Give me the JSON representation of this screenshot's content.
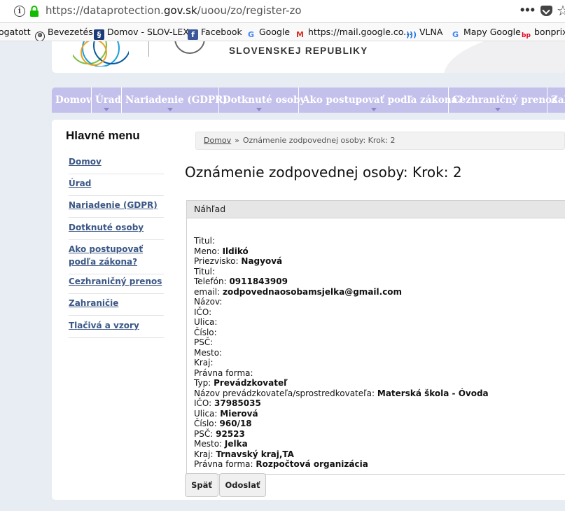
{
  "browser": {
    "url_prefix": "https://dataprotection.",
    "url_domain": "gov.sk",
    "url_path": "/uoou/zo/register-zo",
    "bookmarks": [
      {
        "label": "ogatott",
        "icon": ""
      },
      {
        "label": "Bevezetés",
        "icon": "globe-icon"
      },
      {
        "label": "Domov - SLOV-LEX",
        "icon": "section-icon"
      },
      {
        "label": "Facebook",
        "icon": "facebook-icon"
      },
      {
        "label": "Google",
        "icon": "google-icon"
      },
      {
        "label": "https://mail.google.co...",
        "icon": "gmail-icon"
      },
      {
        "label": "VLNA",
        "icon": "wave-icon"
      },
      {
        "label": "Mapy Google",
        "icon": "google-icon"
      },
      {
        "label": "bonprix",
        "icon": "bonprix-icon"
      }
    ]
  },
  "header": {
    "office_line2": "SLOVENSKEJ REPUBLIKY"
  },
  "nav": [
    "Domov",
    "Úrad",
    "Nariadenie (GDPR)",
    "Dotknuté osoby",
    "Ako postupovať podľa zákona?",
    "Cezhraničný prenos",
    "Zahraničie"
  ],
  "sidebar": {
    "title": "Hlavné menu",
    "items": [
      "Domov",
      "Úrad",
      "Nariadenie (GDPR)",
      "Dotknuté osoby",
      "Ako postupovať podľa zákona?",
      "Cezhraničný prenos",
      "Zahraničie",
      "Tlačivá a vzory"
    ]
  },
  "breadcrumb": {
    "home": "Domov",
    "separator": "»",
    "current": "Oznámenie zodpovednej osoby: Krok: 2"
  },
  "page_title": "Oznámenie zodpovednej osoby: Krok: 2",
  "panel": {
    "title": "Náhľad",
    "rows": [
      {
        "label": "Titul:",
        "value": ""
      },
      {
        "label": "Meno:",
        "value": "Ildikó"
      },
      {
        "label": "Priezvisko:",
        "value": "Nagyová"
      },
      {
        "label": "Titul:",
        "value": ""
      },
      {
        "label": "Telefón:",
        "value": "0911843909"
      },
      {
        "label": "email:",
        "value": "zodpovednaosobamsjelka@gmail.com"
      },
      {
        "label": "Názov:",
        "value": ""
      },
      {
        "label": "IČO:",
        "value": ""
      },
      {
        "label": "Ulica:",
        "value": ""
      },
      {
        "label": "Číslo:",
        "value": ""
      },
      {
        "label": "PSČ:",
        "value": ""
      },
      {
        "label": "Mesto:",
        "value": ""
      },
      {
        "label": "Kraj:",
        "value": ""
      },
      {
        "label": "Právna forma:",
        "value": ""
      },
      {
        "label": "Typ:",
        "value": "Prevádzkovateľ"
      },
      {
        "label": "Názov prevádzkovateľa/sprostredkovateľa:",
        "value": "Materská škola - Óvoda"
      },
      {
        "label": "IČO:",
        "value": "37985035"
      },
      {
        "label": "Ulica:",
        "value": "Mierová"
      },
      {
        "label": "Číslo:",
        "value": "960/18"
      },
      {
        "label": "PSČ:",
        "value": "92523"
      },
      {
        "label": "Mesto:",
        "value": "Jelka"
      },
      {
        "label": "Kraj:",
        "value": "Trnavský kraj,TA"
      },
      {
        "label": "Právna forma:",
        "value": "Rozpočtová organizácia"
      }
    ]
  },
  "buttons": {
    "back": "Späť",
    "submit": "Odoslať"
  },
  "colors": {
    "nav_bg": "#c3c0ec",
    "link": "#3b5785"
  }
}
